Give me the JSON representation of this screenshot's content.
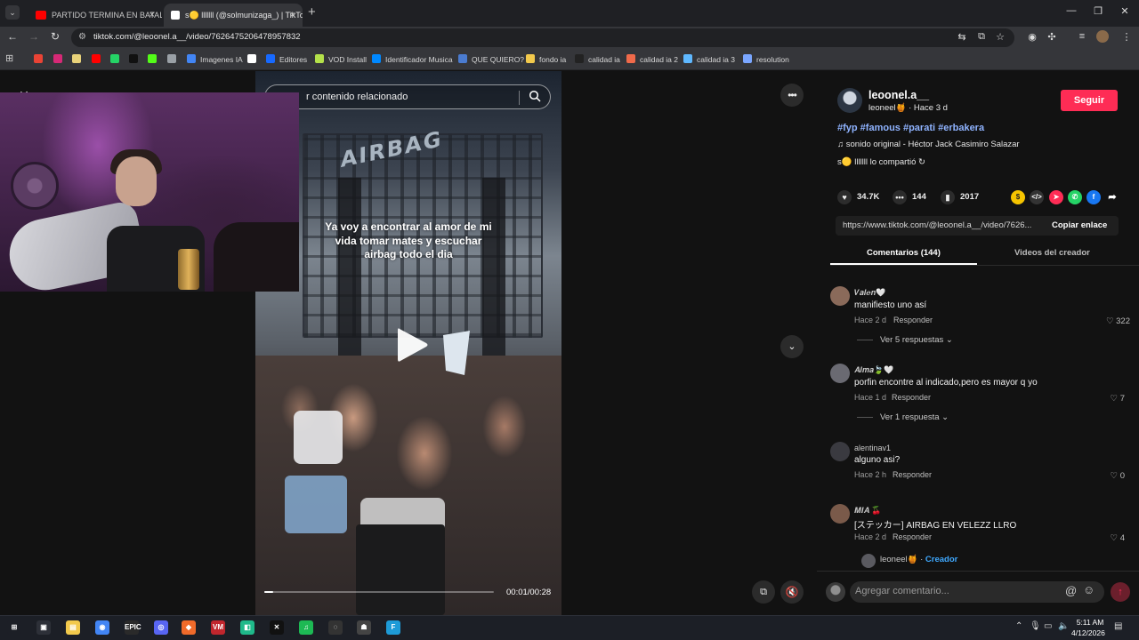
{
  "browser": {
    "tabs": [
      {
        "title": "PARTIDO TERMINA EN BATALLA",
        "favicon_color": "#ff0000"
      },
      {
        "title": "s🟡 lllllll (@solmunizaga_) | TikTok",
        "favicon_color": "#ffffff"
      }
    ],
    "new_tab": "+",
    "tab_close": "×",
    "url": "tiktok.com/@leoonel.a__/video/7626475206478957832",
    "window_controls": {
      "minimize": "—",
      "maximize": "❐",
      "close": "✕"
    },
    "bookmarks": [
      {
        "label": "",
        "icon": "gmail-icon",
        "color": "#ea4335"
      },
      {
        "label": "",
        "icon": "instagram-icon",
        "color": "#d62976"
      },
      {
        "label": "",
        "icon": "bookmark-icon",
        "color": "#e8d27a"
      },
      {
        "label": "",
        "icon": "youtube-icon",
        "color": "#ff0000"
      },
      {
        "label": "",
        "icon": "whatsapp-icon",
        "color": "#25d366"
      },
      {
        "label": "",
        "icon": "tiktok-icon",
        "color": "#111111"
      },
      {
        "label": "",
        "icon": "kick-icon",
        "color": "#53fc18"
      },
      {
        "label": "",
        "icon": "globe-icon",
        "color": "#9aa0a6"
      },
      {
        "label": "Imagenes IA",
        "icon": "search-icon",
        "color": "#4285f4"
      },
      {
        "label": "",
        "icon": "notion-icon",
        "color": "#ffffff"
      },
      {
        "label": "Editores",
        "icon": "behance-icon",
        "color": "#1769ff"
      },
      {
        "label": "VOD Install",
        "icon": "star-icon",
        "color": "#b4e14a"
      },
      {
        "label": "Identificador Musica",
        "icon": "shazam-icon",
        "color": "#0088ff"
      },
      {
        "label": "QUE QUIERO?",
        "icon": "doc-icon",
        "color": "#4a7bd0"
      },
      {
        "label": "fondo ia",
        "icon": "folder-icon",
        "color": "#f2c94c"
      },
      {
        "label": "calidad ia",
        "icon": "k-icon",
        "color": "#222222"
      },
      {
        "label": "calidad ia 2",
        "icon": "flame-icon",
        "color": "#f06a4a"
      },
      {
        "label": "calidad ia 3",
        "icon": "globe-icon",
        "color": "#5fb8ff"
      },
      {
        "label": "resolution",
        "icon": "diamond-icon",
        "color": "#7aa6ff"
      }
    ]
  },
  "video": {
    "search_placeholder": "r contenido relacionado",
    "caption": "Ya voy a encontrar al amor de mi vida tomar mates y escuchar airbag todo el dia",
    "stage_sign": "AIRBAG",
    "time": "00:01/00:28",
    "progress": 0.04
  },
  "post": {
    "author_name": "leoonel.a__",
    "author_sub": "leoneel🍯 · Hace 3 d",
    "follow_label": "Seguir",
    "hashtags": "#fyp #famous #parati #erbakera",
    "music": "♫  sonido original - Héctor Jack Casimiro Salazar",
    "shared": "s🟡 lllllll lo compartió  ↻",
    "likes": "34.7K",
    "comments_count": "144",
    "saves": "2017",
    "link": "https://www.tiktok.com/@leoonel.a__/video/7626...",
    "copy_label": "Copiar enlace",
    "tab_comments": "Comentarios (144)",
    "tab_videos": "Videos del creador"
  },
  "comments": [
    {
      "user": "𝑽𝒂𝒍𝒆𝒏🤍",
      "text": "manifiesto uno así",
      "time": "Hace 2 d",
      "reply": "Responder",
      "likes": "♡ 322",
      "more": "Ver 5 respuestas ⌄",
      "avatar_color": "#8a6a5a"
    },
    {
      "user": "𝑨𝒍𝒎𝒂🍃🤍",
      "text": "porfin encontre al indicado,pero es mayor q yo",
      "time": "Hace 1 d",
      "reply": "Responder",
      "likes": "♡ 7",
      "more": "Ver 1 respuesta ⌄",
      "avatar_color": "#6a6a72"
    },
    {
      "user": "alentinav1",
      "text": "alguno asi?",
      "time": "Hace 2 h",
      "reply": "Responder",
      "likes": "♡ 0",
      "more": "",
      "avatar_color": "#3a3a40"
    },
    {
      "user": "𝑴𝑰𝑨 🍒",
      "text": "[ステッカー] AIRBAG EN VELEZZ LLRO",
      "time": "Hace 2 d",
      "reply": "Responder",
      "likes": "♡ 4",
      "more": "",
      "avatar_color": "#7a5a4a"
    }
  ],
  "creator_chip": {
    "name": "leoneel🍯 · ",
    "tag": "Creador"
  },
  "comment_input": {
    "placeholder": "Agregar comentario...",
    "at": "@",
    "emoji": "☺",
    "send": "↑"
  },
  "taskbar": {
    "time": "5:11 AM",
    "date": "4/12/2026",
    "apps": [
      {
        "label": "⊞",
        "icon": "windows-icon",
        "color": "#1c1f26"
      },
      {
        "label": "▣",
        "icon": "task-view-icon",
        "color": "#2d3038"
      },
      {
        "label": "▤",
        "icon": "file-explorer-icon",
        "color": "#f2c94c"
      },
      {
        "label": "◉",
        "icon": "chrome-icon",
        "color": "#4285f4"
      },
      {
        "label": "EPIC",
        "icon": "epic-games-icon",
        "color": "#2a2a2a"
      },
      {
        "label": "◎",
        "icon": "discord-icon",
        "color": "#5865f2"
      },
      {
        "label": "◆",
        "icon": "brave-icon",
        "color": "#f06a2a"
      },
      {
        "label": "VM",
        "icon": "voicemeeter-icon",
        "color": "#c0262d"
      },
      {
        "label": "◧",
        "icon": "app-icon",
        "color": "#1fb98a"
      },
      {
        "label": "✕",
        "icon": "capcut-icon",
        "color": "#111111"
      },
      {
        "label": "♫",
        "icon": "spotify-icon",
        "color": "#1db954"
      },
      {
        "label": "◌",
        "icon": "obs-icon",
        "color": "#333333"
      },
      {
        "label": "☗",
        "icon": "game-icon",
        "color": "#444444"
      },
      {
        "label": "F",
        "icon": "f-app-icon",
        "color": "#1e9bd7"
      }
    ]
  }
}
